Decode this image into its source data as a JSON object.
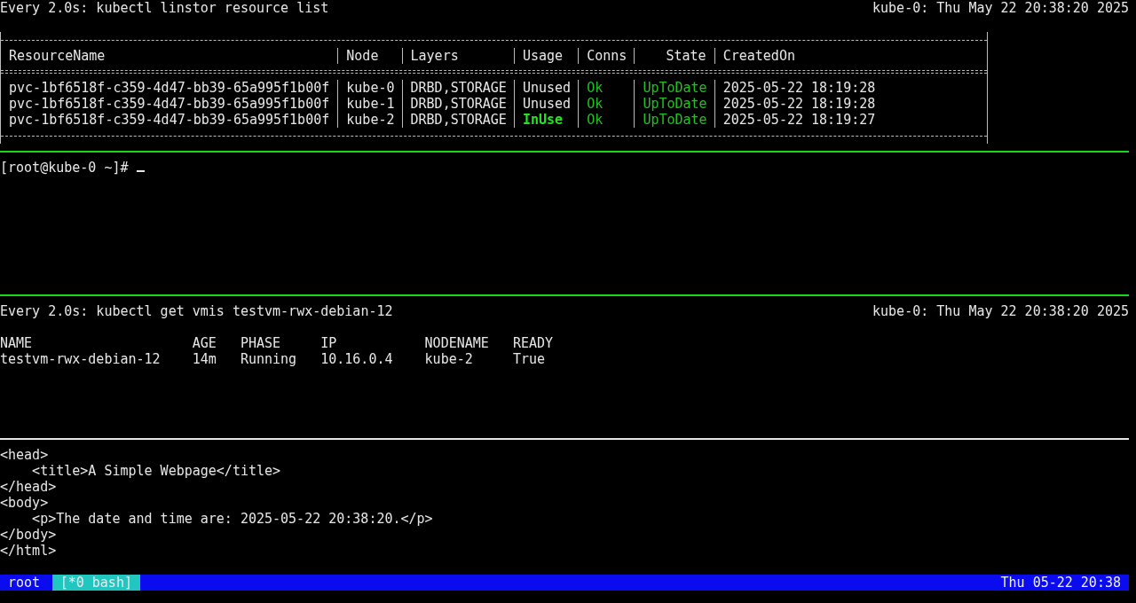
{
  "panes": [
    {
      "kind": "linstor",
      "command": "Every 2.0s: kubectl linstor resource list",
      "host_time": "kube-0: Thu May 22 20:38:20 2025",
      "table": {
        "columns": [
          {
            "label": "ResourceName"
          },
          {
            "label": "Node"
          },
          {
            "label": "Layers"
          },
          {
            "label": "Usage"
          },
          {
            "label": "Conns"
          },
          {
            "label": "State"
          },
          {
            "label": "CreatedOn"
          }
        ],
        "rows": [
          {
            "resource_name": "pvc-1bf6518f-c359-4d47-bb39-65a995f1b00f",
            "node": "kube-0",
            "layers": "DRBD,STORAGE",
            "usage": "Unused",
            "in_use": false,
            "conns": "Ok",
            "conns_ok": true,
            "state": "UpToDate",
            "state_ok": true,
            "created_on": "2025-05-22 18:19:28"
          },
          {
            "resource_name": "pvc-1bf6518f-c359-4d47-bb39-65a995f1b00f",
            "node": "kube-1",
            "layers": "DRBD,STORAGE",
            "usage": "Unused",
            "in_use": false,
            "conns": "Ok",
            "conns_ok": true,
            "state": "UpToDate",
            "state_ok": true,
            "created_on": "2025-05-22 18:19:28"
          },
          {
            "resource_name": "pvc-1bf6518f-c359-4d47-bb39-65a995f1b00f",
            "node": "kube-2",
            "layers": "DRBD,STORAGE",
            "usage": "InUse",
            "in_use": true,
            "conns": "Ok",
            "conns_ok": true,
            "state": "UpToDate",
            "state_ok": true,
            "created_on": "2025-05-22 18:19:27"
          }
        ]
      }
    },
    {
      "kind": "shell",
      "active": true,
      "prompt": "[root@kube-0 ~]#"
    },
    {
      "kind": "vmis",
      "command": "Every 2.0s: kubectl get vmis testvm-rwx-debian-12",
      "host_time": "kube-0: Thu May 22 20:38:20 2025",
      "table": {
        "columns": [
          "NAME",
          "AGE",
          "PHASE",
          "IP",
          "NODENAME",
          "READY"
        ],
        "rows": [
          [
            "testvm-rwx-debian-12",
            "14m",
            "Running",
            "10.16.0.4",
            "kube-2",
            "True"
          ]
        ]
      }
    },
    {
      "kind": "output",
      "lines": [
        {
          "text": "<head>",
          "children": [
            {
              "text": "<title>A Simple Webpage</title>"
            }
          ]
        },
        {
          "text": "</head>"
        },
        {
          "text": "<body>",
          "children": [
            {
              "text": "<p>The date and time are: 2025-05-22 20:38:20.</p>"
            }
          ]
        },
        {
          "text": "</body>"
        },
        {
          "text": "</html>"
        }
      ]
    }
  ],
  "status_bar": {
    "session": "root",
    "windows": [
      {
        "label": "[*0 bash]",
        "selected": true
      }
    ],
    "clock": "Thu 05-22 20:38"
  }
}
